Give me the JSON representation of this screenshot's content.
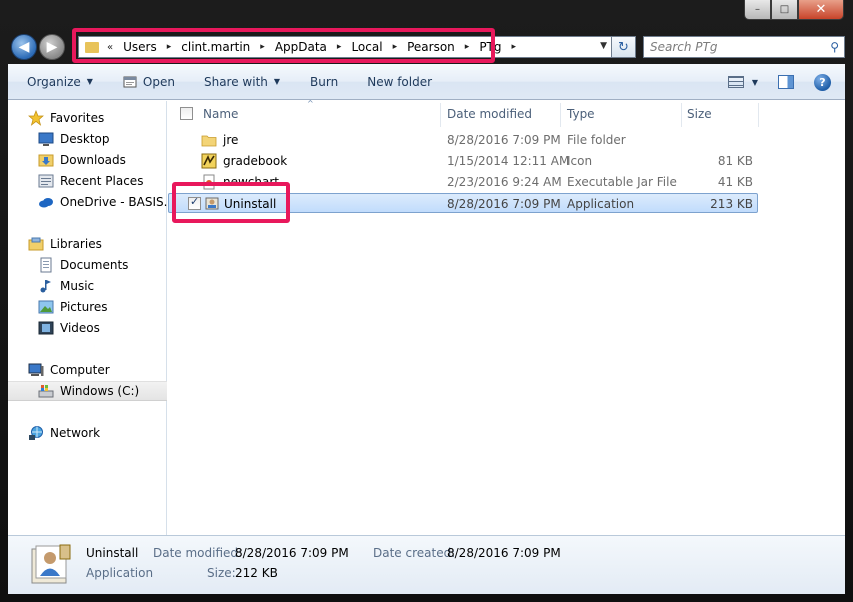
{
  "window": {
    "caption_minimize": "–",
    "caption_maximize": "□",
    "caption_close": "✕"
  },
  "nav": {
    "back_glyph": "◀",
    "forward_glyph": "▶",
    "refresh_glyph": "↻",
    "breadcrumb_lead": "«",
    "breadcrumb_separator": "▸",
    "breadcrumb": [
      "Users",
      "clint.martin",
      "AppData",
      "Local",
      "Pearson",
      "PTg"
    ],
    "address_dropdown_glyph": "▼",
    "search_placeholder": "Search PTg",
    "search_glyph": "⚲"
  },
  "toolbar": {
    "organize": "Organize",
    "open": "Open",
    "share_with": "Share with",
    "burn": "Burn",
    "new_folder": "New folder",
    "dropdown_glyph": "▼",
    "help_glyph": "?"
  },
  "navpane": {
    "favorites": {
      "label": "Favorites",
      "items": [
        "Desktop",
        "Downloads",
        "Recent Places",
        "OneDrive - BASIS.ed"
      ]
    },
    "libraries": {
      "label": "Libraries",
      "items": [
        "Documents",
        "Music",
        "Pictures",
        "Videos"
      ]
    },
    "computer": {
      "label": "Computer",
      "items": [
        "Windows (C:)"
      ]
    },
    "network": {
      "label": "Network"
    }
  },
  "list": {
    "columns": [
      "Name",
      "Date modified",
      "Type",
      "Size"
    ],
    "sort_glyph": "^",
    "rows": [
      {
        "name": "jre",
        "date": "8/28/2016 7:09 PM",
        "type": "File folder",
        "size": "",
        "icon": "folder-icon",
        "selected": false
      },
      {
        "name": "gradebook",
        "date": "1/15/2014 12:11 AM",
        "type": "Icon",
        "size": "81 KB",
        "icon": "gradebook-icon",
        "selected": false
      },
      {
        "name": "newchart",
        "date": "2/23/2016 9:24 AM",
        "type": "Executable Jar File",
        "size": "41 KB",
        "icon": "jar-icon",
        "selected": false
      },
      {
        "name": "Uninstall",
        "date": "8/28/2016 7:09 PM",
        "type": "Application",
        "size": "213 KB",
        "icon": "uninstall-icon",
        "selected": true
      }
    ]
  },
  "details": {
    "name": "Uninstall",
    "type": "Application",
    "date_modified_label": "Date modified:",
    "date_modified": "8/28/2016 7:09 PM",
    "size_label": "Size:",
    "size": "212 KB",
    "date_created_label": "Date created:",
    "date_created": "8/28/2016 7:09 PM"
  },
  "colors": {
    "highlight": "#e8185c",
    "selection": "#c1dcfc"
  }
}
